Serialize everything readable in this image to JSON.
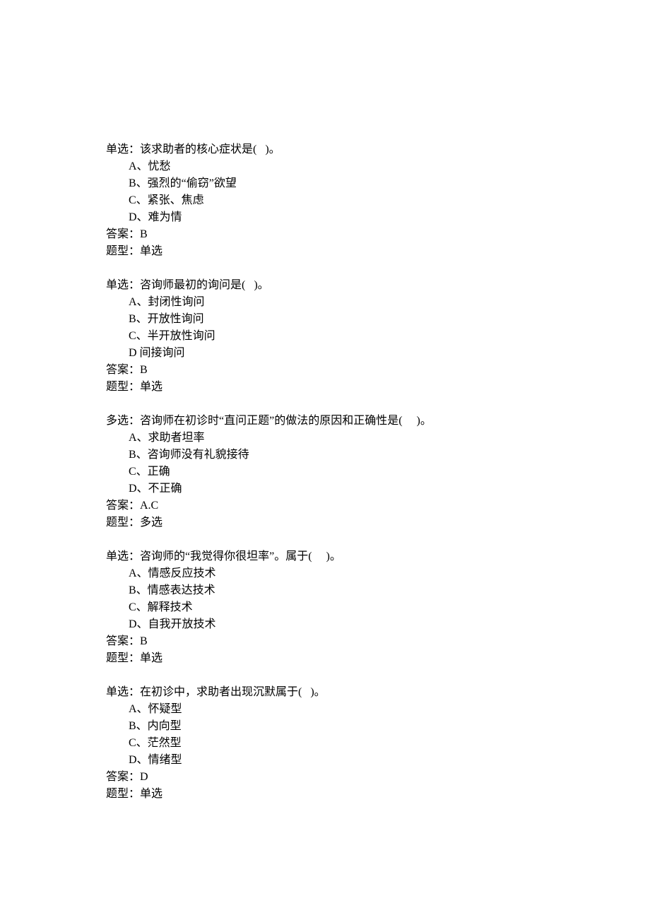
{
  "questions": [
    {
      "stem": "单选：该求助者的核心症状是(   )。",
      "options": [
        "A、忧愁",
        "B、强烈的“偷窃”欲望",
        "C、紧张、焦虑",
        "D、难为情"
      ],
      "answer": "答案：B",
      "qtype": "题型：单选"
    },
    {
      "stem": "单选：咨询师最初的询问是(   )。",
      "options": [
        "A、封闭性询问",
        "B、开放性询问",
        "C、半开放性询问",
        "D 间接询问"
      ],
      "answer": "答案：B",
      "qtype": "题型：单选"
    },
    {
      "stem": "多选：咨询师在初诊时“直问正题”的做法的原因和正确性是(     )。",
      "options": [
        "A、求助者坦率",
        "B、咨询师没有礼貌接待",
        "C、正确",
        "D、不正确"
      ],
      "answer": "答案：A.C",
      "qtype": "题型：多选"
    },
    {
      "stem": "单选：咨询师的“我觉得你很坦率”。属于(     )。",
      "options": [
        "A、情感反应技术",
        "B、情感表达技术",
        "C、解释技术",
        "D、自我开放技术"
      ],
      "answer": "答案：B",
      "qtype": "题型：单选"
    },
    {
      "stem": "单选：在初诊中，求助者出现沉默属于(   )。",
      "options": [
        "A、怀疑型",
        "B、内向型",
        "C、茫然型",
        "D、情绪型"
      ],
      "answer": "答案：D",
      "qtype": "题型：单选"
    }
  ]
}
